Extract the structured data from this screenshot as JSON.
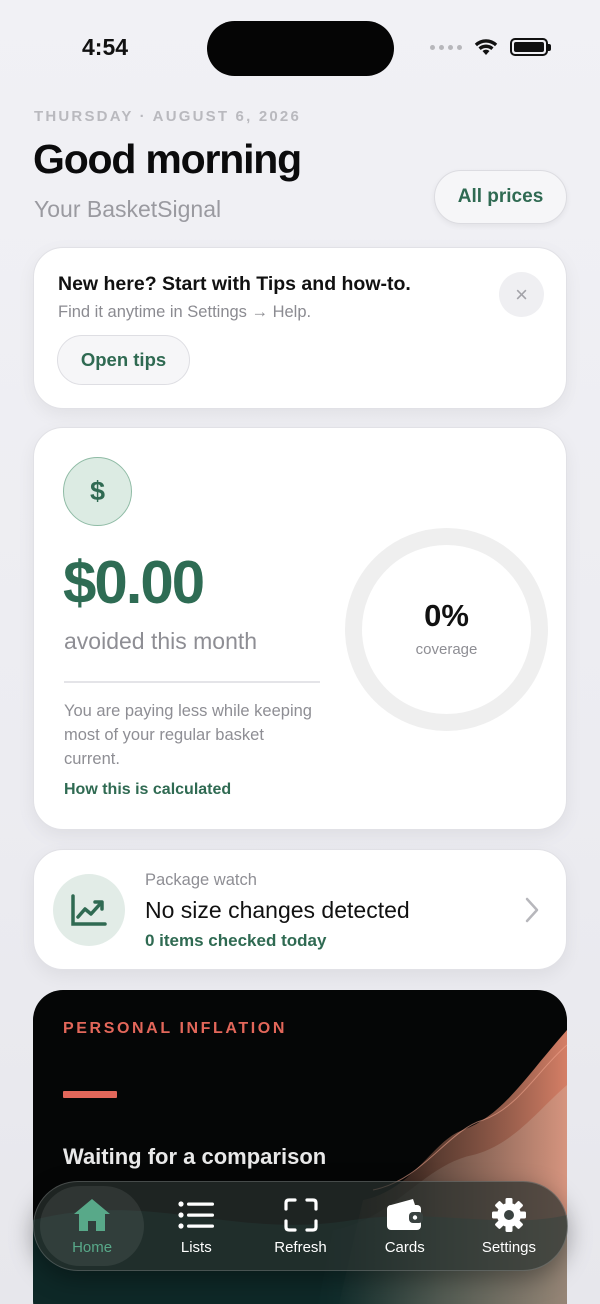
{
  "status_bar": {
    "time": "4:54"
  },
  "header": {
    "date": "THURSDAY · AUGUST 6, 2026",
    "greeting": "Good morning",
    "subtitle": "Your BasketSignal",
    "all_prices_label": "All prices"
  },
  "tips_card": {
    "title": "New here? Start with Tips and how-to.",
    "subtitle": "Find it anytime in Settings → Help.",
    "close_glyph": "×",
    "open_label": "Open tips"
  },
  "savings_card": {
    "currency_symbol": "$",
    "amount": "$0.00",
    "amount_label": "avoided this month",
    "explanation": "You are paying less while keeping most of your regular basket current.",
    "link_label": "How this is calculated",
    "coverage_value": "0%",
    "coverage_label": "coverage",
    "coverage_fraction": 0
  },
  "package_card": {
    "kicker": "Package watch",
    "title": "No size changes detected",
    "status": "0 items checked today",
    "icon": "trend-chart-icon"
  },
  "inflation_card": {
    "kicker": "PERSONAL INFLATION",
    "message": "Waiting for a comparison"
  },
  "tab_bar": {
    "tabs": [
      {
        "label": "Home",
        "icon": "house-icon",
        "active": true
      },
      {
        "label": "Lists",
        "icon": "list-icon",
        "active": false
      },
      {
        "label": "Refresh",
        "icon": "scan-frame-icon",
        "active": false
      },
      {
        "label": "Cards",
        "icon": "wallet-icon",
        "active": false
      },
      {
        "label": "Settings",
        "icon": "gear-icon",
        "active": false
      }
    ]
  },
  "colors": {
    "accent_green": "#2f6a52",
    "accent_coral": "#e3675a",
    "tab_active": "#58a989"
  }
}
